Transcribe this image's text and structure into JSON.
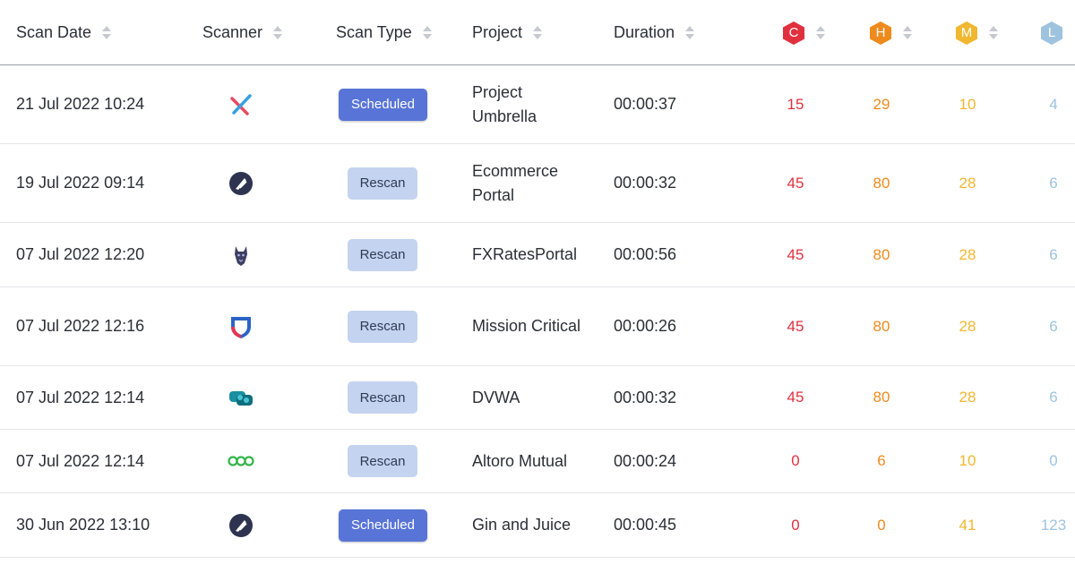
{
  "columns": {
    "scan_date": "Scan Date",
    "scanner": "Scanner",
    "scan_type": "Scan Type",
    "project": "Project",
    "duration": "Duration",
    "critical": "C",
    "high": "H",
    "medium": "M",
    "low": "L"
  },
  "severity_colors": {
    "critical": "#e0303e",
    "high": "#ef8a1c",
    "medium": "#f0b72f",
    "low": "#9ec3df"
  },
  "rows": [
    {
      "date": "21 Jul 2022 10:24",
      "scanner_icon": "cross-scanner-icon",
      "scan_type": "Scheduled",
      "project": "Project Umbrella",
      "duration": "00:00:37",
      "c": "15",
      "h": "29",
      "m": "10",
      "l": "4"
    },
    {
      "date": "19 Jul 2022 09:14",
      "scanner_icon": "burp-scanner-icon",
      "scan_type": "Rescan",
      "project": "Ecommerce Portal",
      "duration": "00:00:32",
      "c": "45",
      "h": "80",
      "m": "28",
      "l": "6"
    },
    {
      "date": "07 Jul 2022 12:20",
      "scanner_icon": "wolf-scanner-icon",
      "scan_type": "Rescan",
      "project": "FXRatesPortal",
      "duration": "00:00:56",
      "c": "45",
      "h": "80",
      "m": "28",
      "l": "6"
    },
    {
      "date": "07 Jul 2022 12:16",
      "scanner_icon": "shield-scanner-icon",
      "scan_type": "Rescan",
      "project": "Mission Critical",
      "duration": "00:00:26",
      "c": "45",
      "h": "80",
      "m": "28",
      "l": "6"
    },
    {
      "date": "07 Jul 2022 12:14",
      "scanner_icon": "cloud-scanner-icon",
      "scan_type": "Rescan",
      "project": "DVWA",
      "duration": "00:00:32",
      "c": "45",
      "h": "80",
      "m": "28",
      "l": "6"
    },
    {
      "date": "07 Jul 2022 12:14",
      "scanner_icon": "rings-scanner-icon",
      "scan_type": "Rescan",
      "project": "Altoro Mutual",
      "duration": "00:00:24",
      "c": "0",
      "h": "6",
      "m": "10",
      "l": "0"
    },
    {
      "date": "30 Jun 2022 13:10",
      "scanner_icon": "burp-scanner-icon",
      "scan_type": "Scheduled",
      "project": "Gin and Juice",
      "duration": "00:00:45",
      "c": "0",
      "h": "0",
      "m": "41",
      "l": "123"
    }
  ]
}
